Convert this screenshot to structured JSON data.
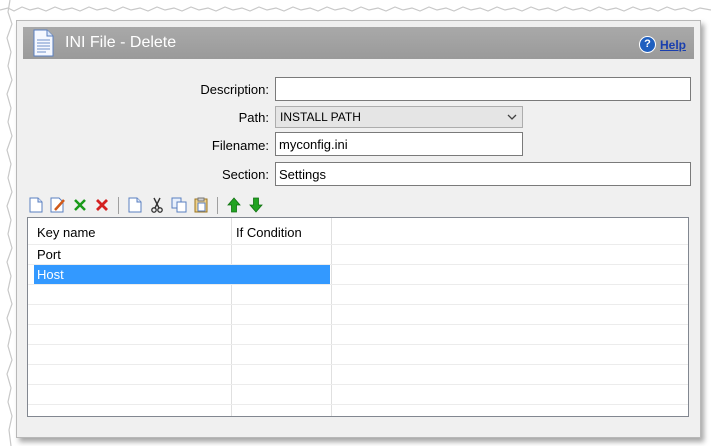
{
  "window": {
    "title": "INI File - Delete",
    "help_label": "Help",
    "help_icon": "question-circle-icon"
  },
  "form": {
    "description": {
      "label": "Description:",
      "value": ""
    },
    "path": {
      "label": "Path:",
      "value": "INSTALL PATH"
    },
    "filename": {
      "label": "Filename:",
      "value": "myconfig.ini"
    },
    "section": {
      "label": "Section:",
      "value": "Settings"
    }
  },
  "toolbar": {
    "buttons": [
      "new-document-icon",
      "edit-document-icon",
      "check-icon",
      "delete-x-icon",
      "copy-page-icon",
      "cut-scissors-icon",
      "duplicate-icon",
      "paste-clipboard-icon",
      "arrow-up-icon",
      "arrow-down-icon"
    ]
  },
  "grid": {
    "columns": [
      "Key name",
      "If Condition"
    ],
    "rows": [
      {
        "key": "Port",
        "condition": "",
        "selected": false
      },
      {
        "key": "Host",
        "condition": "",
        "selected": true
      }
    ],
    "selection_color": "#3399ff"
  },
  "colors": {
    "title_bar": "#a0a0a0",
    "panel_bg": "#f0f0f0",
    "up_arrow": "#1a9a1a",
    "delete_red": "#d42020"
  }
}
